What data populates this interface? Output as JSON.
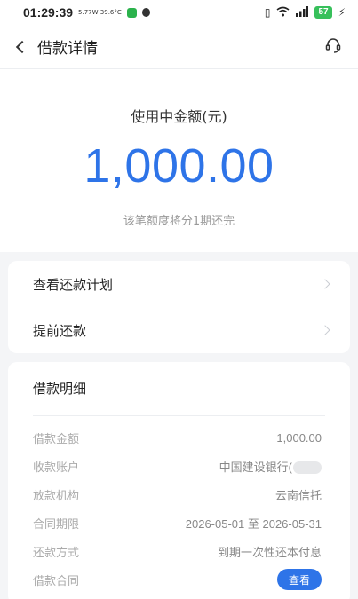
{
  "status_bar": {
    "time": "01:29:39",
    "network_speed": "5.77W",
    "temperature": "39.6°C",
    "battery": "57"
  },
  "nav": {
    "title": "借款详情",
    "support_icon": "customer-service-icon"
  },
  "hero": {
    "label": "使用中金额(元)",
    "amount": "1,000.00",
    "note": "该笔额度将分1期还完",
    "amount_color": "#2e74e8"
  },
  "actions": [
    {
      "label": "查看还款计划"
    },
    {
      "label": "提前还款"
    }
  ],
  "detail": {
    "title": "借款明细",
    "rows": [
      {
        "label": "借款金额",
        "value": "1,000.00"
      },
      {
        "label": "收款账户",
        "value": "中国建设银行("
      },
      {
        "label": "放款机构",
        "value": "云南信托"
      },
      {
        "label": "合同期限",
        "value": "2026-05-01 至 2026-05-31"
      },
      {
        "label": "还款方式",
        "value": "到期一次性还本付息"
      },
      {
        "label": "借款合同",
        "button": "查看"
      }
    ]
  }
}
